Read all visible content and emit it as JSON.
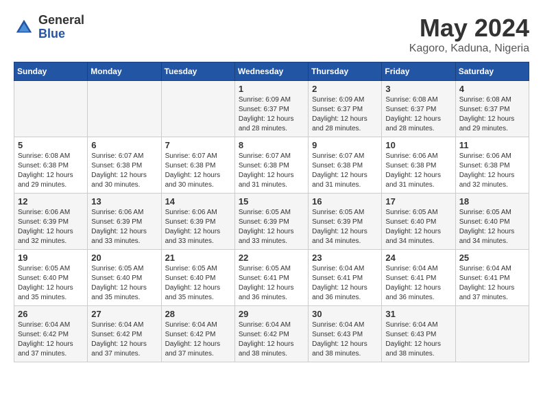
{
  "logo": {
    "general": "General",
    "blue": "Blue"
  },
  "title": "May 2024",
  "location": "Kagoro, Kaduna, Nigeria",
  "weekdays": [
    "Sunday",
    "Monday",
    "Tuesday",
    "Wednesday",
    "Thursday",
    "Friday",
    "Saturday"
  ],
  "weeks": [
    [
      {
        "day": "",
        "info": ""
      },
      {
        "day": "",
        "info": ""
      },
      {
        "day": "",
        "info": ""
      },
      {
        "day": "1",
        "info": "Sunrise: 6:09 AM\nSunset: 6:37 PM\nDaylight: 12 hours\nand 28 minutes."
      },
      {
        "day": "2",
        "info": "Sunrise: 6:09 AM\nSunset: 6:37 PM\nDaylight: 12 hours\nand 28 minutes."
      },
      {
        "day": "3",
        "info": "Sunrise: 6:08 AM\nSunset: 6:37 PM\nDaylight: 12 hours\nand 28 minutes."
      },
      {
        "day": "4",
        "info": "Sunrise: 6:08 AM\nSunset: 6:37 PM\nDaylight: 12 hours\nand 29 minutes."
      }
    ],
    [
      {
        "day": "5",
        "info": "Sunrise: 6:08 AM\nSunset: 6:38 PM\nDaylight: 12 hours\nand 29 minutes."
      },
      {
        "day": "6",
        "info": "Sunrise: 6:07 AM\nSunset: 6:38 PM\nDaylight: 12 hours\nand 30 minutes."
      },
      {
        "day": "7",
        "info": "Sunrise: 6:07 AM\nSunset: 6:38 PM\nDaylight: 12 hours\nand 30 minutes."
      },
      {
        "day": "8",
        "info": "Sunrise: 6:07 AM\nSunset: 6:38 PM\nDaylight: 12 hours\nand 31 minutes."
      },
      {
        "day": "9",
        "info": "Sunrise: 6:07 AM\nSunset: 6:38 PM\nDaylight: 12 hours\nand 31 minutes."
      },
      {
        "day": "10",
        "info": "Sunrise: 6:06 AM\nSunset: 6:38 PM\nDaylight: 12 hours\nand 31 minutes."
      },
      {
        "day": "11",
        "info": "Sunrise: 6:06 AM\nSunset: 6:38 PM\nDaylight: 12 hours\nand 32 minutes."
      }
    ],
    [
      {
        "day": "12",
        "info": "Sunrise: 6:06 AM\nSunset: 6:39 PM\nDaylight: 12 hours\nand 32 minutes."
      },
      {
        "day": "13",
        "info": "Sunrise: 6:06 AM\nSunset: 6:39 PM\nDaylight: 12 hours\nand 33 minutes."
      },
      {
        "day": "14",
        "info": "Sunrise: 6:06 AM\nSunset: 6:39 PM\nDaylight: 12 hours\nand 33 minutes."
      },
      {
        "day": "15",
        "info": "Sunrise: 6:05 AM\nSunset: 6:39 PM\nDaylight: 12 hours\nand 33 minutes."
      },
      {
        "day": "16",
        "info": "Sunrise: 6:05 AM\nSunset: 6:39 PM\nDaylight: 12 hours\nand 34 minutes."
      },
      {
        "day": "17",
        "info": "Sunrise: 6:05 AM\nSunset: 6:40 PM\nDaylight: 12 hours\nand 34 minutes."
      },
      {
        "day": "18",
        "info": "Sunrise: 6:05 AM\nSunset: 6:40 PM\nDaylight: 12 hours\nand 34 minutes."
      }
    ],
    [
      {
        "day": "19",
        "info": "Sunrise: 6:05 AM\nSunset: 6:40 PM\nDaylight: 12 hours\nand 35 minutes."
      },
      {
        "day": "20",
        "info": "Sunrise: 6:05 AM\nSunset: 6:40 PM\nDaylight: 12 hours\nand 35 minutes."
      },
      {
        "day": "21",
        "info": "Sunrise: 6:05 AM\nSunset: 6:40 PM\nDaylight: 12 hours\nand 35 minutes."
      },
      {
        "day": "22",
        "info": "Sunrise: 6:05 AM\nSunset: 6:41 PM\nDaylight: 12 hours\nand 36 minutes."
      },
      {
        "day": "23",
        "info": "Sunrise: 6:04 AM\nSunset: 6:41 PM\nDaylight: 12 hours\nand 36 minutes."
      },
      {
        "day": "24",
        "info": "Sunrise: 6:04 AM\nSunset: 6:41 PM\nDaylight: 12 hours\nand 36 minutes."
      },
      {
        "day": "25",
        "info": "Sunrise: 6:04 AM\nSunset: 6:41 PM\nDaylight: 12 hours\nand 37 minutes."
      }
    ],
    [
      {
        "day": "26",
        "info": "Sunrise: 6:04 AM\nSunset: 6:42 PM\nDaylight: 12 hours\nand 37 minutes."
      },
      {
        "day": "27",
        "info": "Sunrise: 6:04 AM\nSunset: 6:42 PM\nDaylight: 12 hours\nand 37 minutes."
      },
      {
        "day": "28",
        "info": "Sunrise: 6:04 AM\nSunset: 6:42 PM\nDaylight: 12 hours\nand 37 minutes."
      },
      {
        "day": "29",
        "info": "Sunrise: 6:04 AM\nSunset: 6:42 PM\nDaylight: 12 hours\nand 38 minutes."
      },
      {
        "day": "30",
        "info": "Sunrise: 6:04 AM\nSunset: 6:43 PM\nDaylight: 12 hours\nand 38 minutes."
      },
      {
        "day": "31",
        "info": "Sunrise: 6:04 AM\nSunset: 6:43 PM\nDaylight: 12 hours\nand 38 minutes."
      },
      {
        "day": "",
        "info": ""
      }
    ]
  ]
}
